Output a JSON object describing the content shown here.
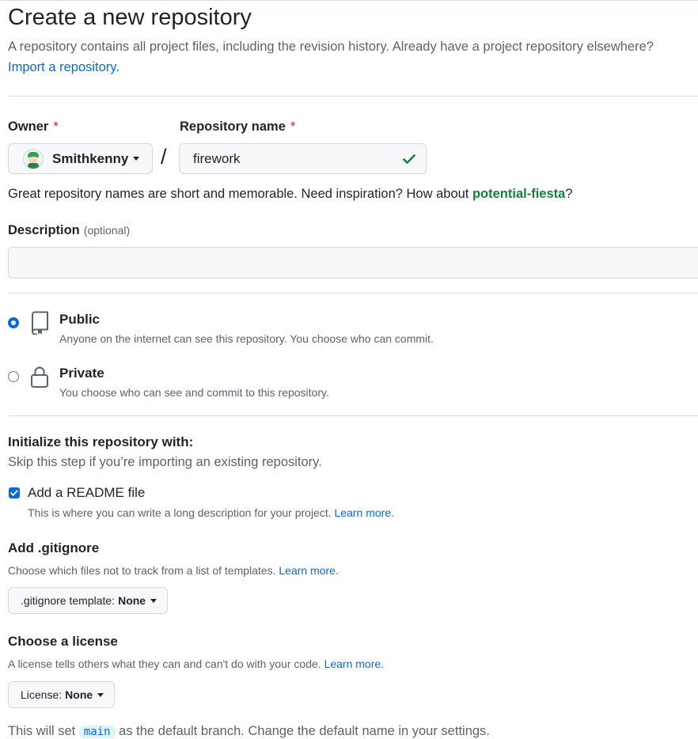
{
  "header": {
    "title": "Create a new repository",
    "subtitle": "A repository contains all project files, including the revision history. Already have a project repository elsewhere?",
    "import_link": "Import a repository."
  },
  "owner": {
    "label": "Owner",
    "required_mark": "*",
    "name": "Smithkenny",
    "icon": "avatar"
  },
  "repo_name": {
    "label": "Repository name",
    "required_mark": "*",
    "separator": "/",
    "value": "firework",
    "valid_icon": "check-icon",
    "hint_prefix": "Great repository names are short and memorable. Need inspiration? How about ",
    "suggestion": "potential-fiesta",
    "hint_suffix": "?"
  },
  "description": {
    "label": "Description",
    "optional": "(optional)",
    "value": ""
  },
  "visibility": {
    "options": [
      {
        "title": "Public",
        "desc": "Anyone on the internet can see this repository. You choose who can commit.",
        "selected": true,
        "icon": "repo-icon"
      },
      {
        "title": "Private",
        "desc": "You choose who can see and commit to this repository.",
        "selected": false,
        "icon": "lock-icon"
      }
    ]
  },
  "init": {
    "title": "Initialize this repository with:",
    "subtitle": "Skip this step if you’re importing an existing repository.",
    "readme": {
      "label": "Add a README file",
      "checked": true,
      "desc": "This is where you can write a long description for your project.",
      "learn_more": "Learn more."
    }
  },
  "gitignore": {
    "title": "Add .gitignore",
    "desc": "Choose which files not to track from a list of templates.",
    "learn_more": "Learn more.",
    "select_prefix": ".gitignore template:",
    "select_value": "None"
  },
  "license": {
    "title": "Choose a license",
    "desc": "A license tells others what they can and can't do with your code.",
    "learn_more": "Learn more.",
    "select_prefix": "License:",
    "select_value": "None"
  },
  "branch_note": {
    "prefix": "This will set ",
    "branch": "main",
    "suffix": " as the default branch. Change the default name in your settings."
  },
  "colors": {
    "link": "#0969da",
    "suggestion": "#1a7f37",
    "required": "#d1242f",
    "check": "#1a7f37"
  }
}
